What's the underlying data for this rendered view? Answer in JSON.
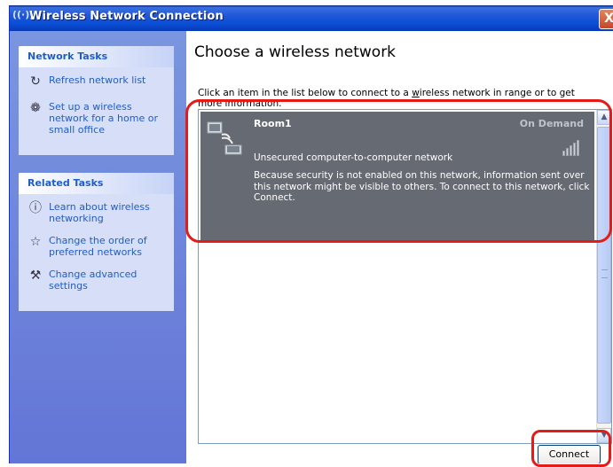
{
  "window": {
    "title": "Wireless Network Connection",
    "close_label": "X"
  },
  "network_tasks": {
    "header": "Network Tasks",
    "items": [
      {
        "label": "Refresh network list",
        "icon": "refresh-icon"
      },
      {
        "label": "Set up a wireless network for a home or small office",
        "icon": "wireless-setup-icon"
      }
    ]
  },
  "related_tasks": {
    "header": "Related Tasks",
    "items": [
      {
        "label": "Learn about wireless networking",
        "icon": "info-icon"
      },
      {
        "label": "Change the order of preferred networks",
        "icon": "star-icon"
      },
      {
        "label": "Change advanced settings",
        "icon": "settings-icon"
      }
    ]
  },
  "main": {
    "heading": "Choose a wireless network",
    "instruction_pre": "Click an item in the list below to connect to a ",
    "instruction_link": "w",
    "instruction_post": "ireless network in range or to get more information.",
    "connect_label": "Connect"
  },
  "network": {
    "name": "Room1",
    "status": "On Demand",
    "security": "Unsecured computer-to-computer network",
    "description": "Because security is not enabled on this network, information sent over this network might be visible to others. To connect to this network, click Connect.",
    "signal_level": 1.0
  },
  "colors": {
    "highlight": "#e41b17",
    "selected_item": "#666a72",
    "titlebar": "#0a4fd6"
  }
}
